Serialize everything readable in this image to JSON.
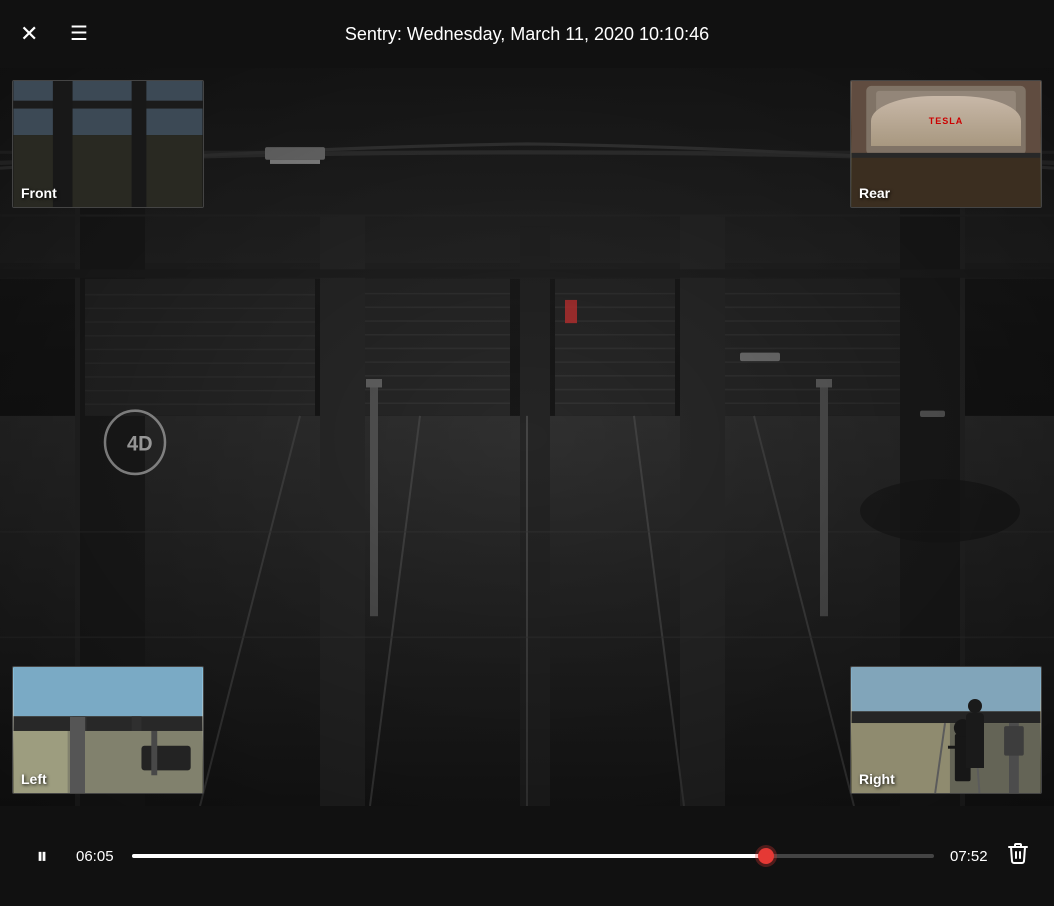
{
  "header": {
    "title": "Sentry: Wednesday, March 11, 2020 10:10:46",
    "close_label": "✕",
    "menu_label": "☰"
  },
  "pips": {
    "front": {
      "label": "Front"
    },
    "rear": {
      "label": "Rear"
    },
    "left": {
      "label": "Left"
    },
    "right": {
      "label": "Right"
    }
  },
  "controls": {
    "play_pause_icon": "⏸",
    "time_current": "06:05",
    "time_total": "07:52",
    "delete_icon": "🗑",
    "progress_percent": 79
  }
}
